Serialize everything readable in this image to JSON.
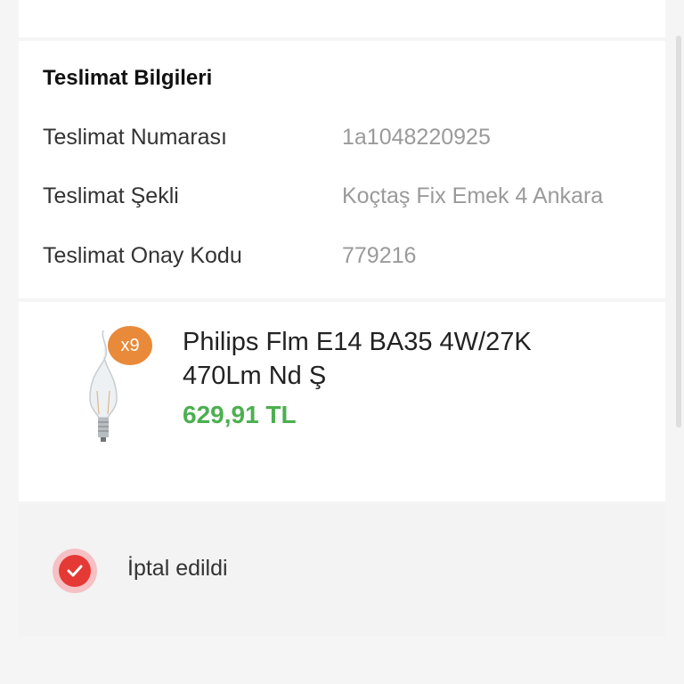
{
  "delivery": {
    "title": "Teslimat Bilgileri",
    "rows": [
      {
        "label": "Teslimat Numarası",
        "value": "1a1048220925"
      },
      {
        "label": "Teslimat Şekli",
        "value": "Koçtaş Fix Emek 4 Ankara"
      },
      {
        "label": "Teslimat Onay Kodu",
        "value": "779216"
      }
    ]
  },
  "product": {
    "quantity_badge": "x9",
    "name": "Philips Flm E14 BA35 4W/27K 470Lm Nd Ş",
    "price": "629,91 TL",
    "image_icon": "light-bulb-icon"
  },
  "status": {
    "icon": "check-circle-icon",
    "label": "İptal edildi"
  },
  "colors": {
    "price": "#4caf50",
    "badge": "#e88a3a",
    "status_icon": "#e53935"
  }
}
